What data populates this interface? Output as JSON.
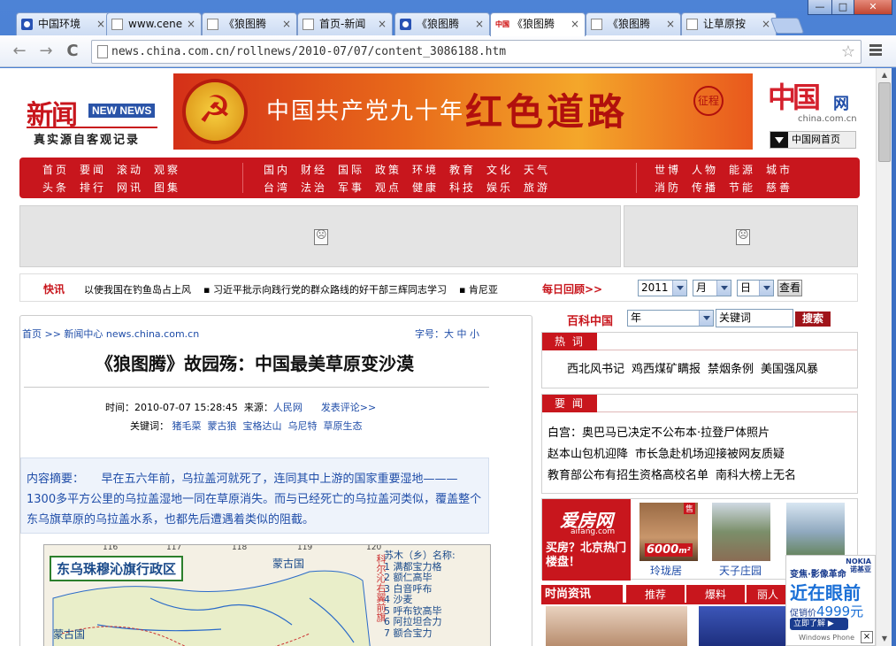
{
  "browser": {
    "tabs": [
      {
        "label": "中国环境",
        "icon": "paw-icon"
      },
      {
        "label": "www.cene",
        "icon": "page-icon"
      },
      {
        "label": "《狼图腾",
        "icon": "page-icon"
      },
      {
        "label": "首页-新闻",
        "icon": "page-icon"
      },
      {
        "label": "《狼图腾",
        "icon": "paw-icon"
      },
      {
        "label": "《狼图腾",
        "icon": "china-icon"
      },
      {
        "label": "《狼图腾",
        "icon": "page-icon"
      },
      {
        "label": "让草原按",
        "icon": "page-icon"
      }
    ],
    "tab_close": "×",
    "window_buttons": {
      "minimize": "—",
      "maximize": "□",
      "close": "✕"
    },
    "url": "news.china.com.cn/rollnews/2010-07/07/content_3086188.htm",
    "back_icon": "←",
    "forward_icon": "→",
    "reload_icon": "C",
    "star_icon": "☆"
  },
  "header": {
    "logo_text": "新闻",
    "logo_badge": "NEW NEWS",
    "slogan": "真实源自客观记录",
    "banner_left": "中国共产党九十年",
    "banner_right": "红色道路",
    "banner_seal": "征程",
    "china_logo": "中国",
    "china_logo_wang": "网",
    "china_domain": "china.com.cn",
    "china_home": "中国网首页"
  },
  "nav": [
    [
      [
        "首页",
        "头条"
      ],
      [
        "要闻",
        "排行"
      ],
      [
        "滚动",
        "网讯"
      ],
      [
        "观察",
        "图集"
      ]
    ],
    [
      [
        "国内",
        "台湾"
      ],
      [
        "财经",
        "法治"
      ],
      [
        "国际",
        "军事"
      ],
      [
        "政策",
        "观点"
      ],
      [
        "环境",
        "健康"
      ],
      [
        "教育",
        "科技"
      ],
      [
        "文化",
        "娱乐"
      ],
      [
        "天气",
        "旅游"
      ]
    ],
    [
      [
        "世博",
        "消防"
      ],
      [
        "人物",
        "传播"
      ],
      [
        "能源",
        "节能"
      ],
      [
        "城市",
        "慈善"
      ]
    ]
  ],
  "kuaixun": {
    "label": "快讯",
    "items": [
      "以使我国在钓鱼岛占上风",
      "▪ 习近平批示向践行党的群众路线的好干部三辉同志学习",
      "▪ 肯尼亚"
    ],
    "review": "每日回顾>>",
    "year": "2011",
    "month": "月",
    "day": "日",
    "go": "查看"
  },
  "article": {
    "crumb": "首页 >> 新闻中心 news.china.com.cn",
    "font_label": "字号：大 中 小",
    "title": "《狼图腾》故园殇：中国最美草原变沙漠",
    "time_label": "时间：",
    "time": "2010-07-07 15:28:45",
    "source_label": "来源：",
    "source": "人民网",
    "comment": "发表评论>>",
    "keywords_label": "关键词：",
    "keywords": [
      "猪毛菜",
      "蒙古狼",
      "宝格达山",
      "乌尼特",
      "草原生态"
    ],
    "summary": "内容摘要：　　早在五六年前，乌拉盖河就死了，连同其中上游的国家重要湿地———1300多平方公里的乌拉盖湿地一同在草原消失。而与已经死亡的乌拉盖河类似，覆盖整个东乌旗草原的乌拉盖水系，也都先后遭遇着类似的阻截。",
    "map": {
      "title": "东乌珠穆沁旗行政区",
      "ticks": [
        "116",
        "117",
        "118",
        "119",
        "120"
      ],
      "names": [
        "蒙古国",
        "蒙古国",
        "科尔沁右翼前旗"
      ],
      "legend_title": "苏木（乡）名称:",
      "legend": [
        "1 满都宝力格",
        "2 额仁高毕",
        "3 白音呼布",
        "4 沙麦",
        "5 呼布钦高毕",
        "6 阿拉坦合力",
        "7 额合宝力"
      ]
    }
  },
  "right": {
    "baike_label": "百科中国",
    "baike_select": "年",
    "baike_keyword": "关键词",
    "baike_btn": "搜索",
    "hot_title": "热 词",
    "hot": [
      "西北风书记",
      "鸡西煤矿瞒报",
      "禁烟条例",
      "美国强风暴"
    ],
    "imp_title": "要 闻",
    "imp": [
      [
        "白宫：奥巴马已决定不公布本·拉登尸体照片"
      ],
      [
        "赵本山包机迎降",
        "市长急赴机场迎接被网友质疑"
      ],
      [
        "教育部公布有招生资格高校名单",
        "南科大榜上无名"
      ]
    ],
    "ifang_name": "爱房网",
    "ifang_domain": "aifang.com",
    "ifang_slogan": "买房？北京热门楼盘！",
    "ifang_price": "6000",
    "ifang_unit": "m²",
    "ifang_sale": "售",
    "ifang_captions": [
      "玲珑居",
      "天子庄园"
    ],
    "fashion_title": "时尚资讯",
    "fashion_tabs": [
      "推荐",
      "爆料",
      "丽人"
    ],
    "nokia": {
      "brand": "NOKIA",
      "brand2": "诺基亚",
      "l1": "变焦·影像革命",
      "l2": "近在眼前",
      "l3": "促销价",
      "price": "4999元",
      "btn": "立即了解 ▶",
      "wp": "Windows Phone",
      "close": "×"
    }
  }
}
